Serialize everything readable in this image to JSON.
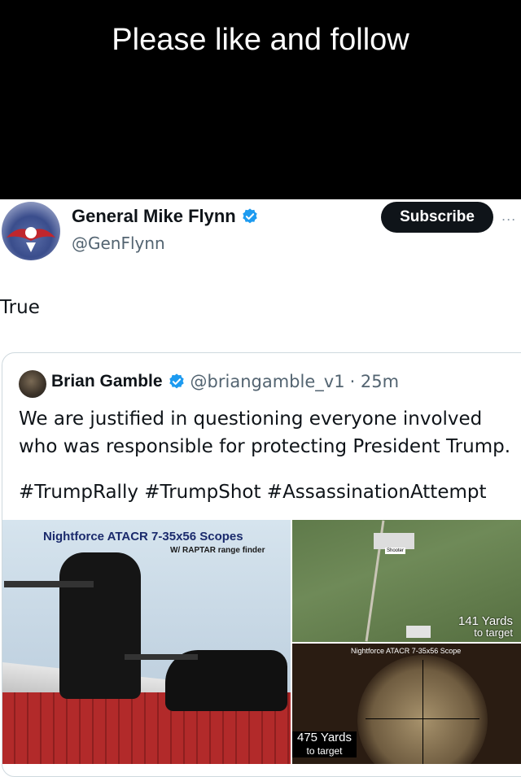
{
  "banner": {
    "text": "Please like and follow"
  },
  "post": {
    "author": {
      "name": "General Mike Flynn",
      "handle": "@GenFlynn",
      "verified": true
    },
    "subscribe_label": "Subscribe",
    "more_label": "...",
    "text": "True"
  },
  "quoted": {
    "author": {
      "name": "Brian Gamble",
      "handle": "@briangamble_v1",
      "time": "· 25m",
      "verified": true
    },
    "body": "We are justified in questioning everyone involved who was responsible for protecting President Trump.",
    "hashtags": "#TrumpRally #TrumpShot #AssassinationAttempt",
    "media": {
      "left_caption": "Nightforce ATACR 7-35x56 Scopes",
      "left_subcaption": "W/ RAPTAR range finder",
      "aerial_label": "Shooter",
      "aerial_distance": "141 Yards",
      "aerial_distance_sub": "to target",
      "scope_label": "Nightforce ATACR 7-35x56 Scope",
      "scope_distance": "475 Yards",
      "scope_distance_sub": "to target"
    }
  },
  "colors": {
    "verified": "#1d9bf0",
    "subscribe_bg": "#0f1419",
    "muted": "#536471"
  }
}
